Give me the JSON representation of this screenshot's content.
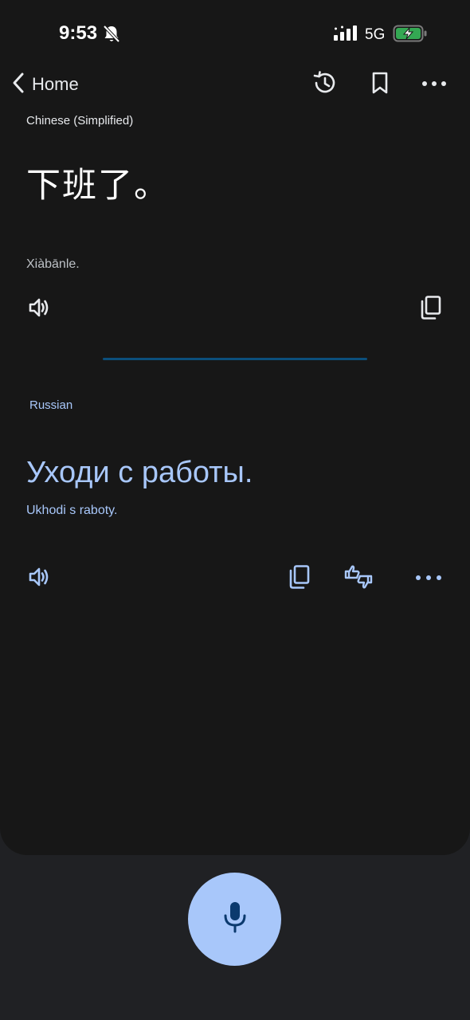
{
  "status_bar": {
    "time": "9:53",
    "network": "5G",
    "icons": [
      "bell-off-icon",
      "signal-icon",
      "battery-charging-icon"
    ],
    "battery_color": "#34a853"
  },
  "header": {
    "back_label": "Home",
    "icons": [
      "chevron-left-icon",
      "history-icon",
      "bookmark-icon",
      "more-horizontal-icon"
    ]
  },
  "source": {
    "language": "Chinese (Simplified)",
    "text": "下班了。",
    "transliteration": "Xiàbānle.",
    "icons": [
      "speaker-icon",
      "copy-icon"
    ]
  },
  "target": {
    "language": "Russian",
    "text": "Уходи с работы.",
    "transliteration": "Ukhodi s raboty.",
    "icons": [
      "speaker-icon",
      "copy-icon",
      "feedback-icon",
      "more-horizontal-icon"
    ]
  },
  "mic": {
    "icon": "microphone-icon"
  },
  "colors": {
    "card_background": "#171717",
    "page_background": "#202124",
    "accent": "#a8c7fa",
    "divider": "#0b4f7c"
  }
}
